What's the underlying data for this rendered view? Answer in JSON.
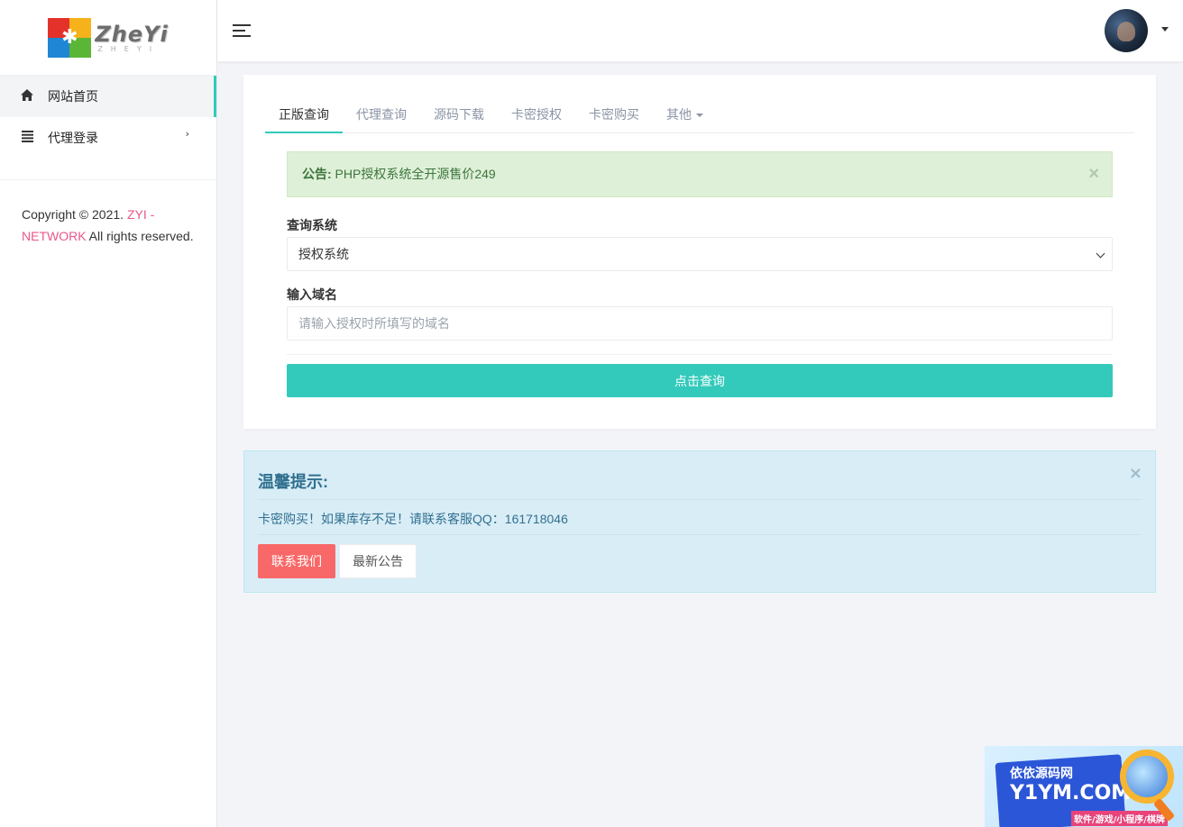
{
  "logo": {
    "title": "ZheYi",
    "subtitle": "ZHEYI"
  },
  "sidebar": {
    "items": [
      {
        "label": "网站首页",
        "icon": "home-icon",
        "active": true
      },
      {
        "label": "代理登录",
        "icon": "list-icon",
        "has_submenu": true
      }
    ],
    "copyright": {
      "prefix": "Copyright © 2021. ",
      "brand": "ZYI - NETWORK",
      "suffix": " All rights reserved."
    }
  },
  "topbar": {
    "menu_icon": "hamburger-icon",
    "avatar_icon": "user-avatar"
  },
  "tabs": [
    {
      "label": "正版查询",
      "active": true
    },
    {
      "label": "代理查询"
    },
    {
      "label": "源码下载"
    },
    {
      "label": "卡密授权"
    },
    {
      "label": "卡密购买"
    },
    {
      "label": "其他",
      "dropdown": true
    }
  ],
  "notice": {
    "prefix": "公告:",
    "text": " PHP授权系统全开源售价249",
    "close": "×"
  },
  "form": {
    "system_label": "查询系统",
    "system_value": "授权系统",
    "domain_label": "输入域名",
    "domain_placeholder": "请输入授权时所填写的域名",
    "submit_label": "点击查询"
  },
  "tips": {
    "title": "温馨提示:",
    "text": "卡密购买！如果库存不足！请联系客服QQ：161718046",
    "close": "×",
    "contact_label": "联系我们",
    "notice_label": "最新公告"
  },
  "watermark": {
    "cn": "依依源码网",
    "en": "Y1YM.COM",
    "sub": "软件/游戏/小程序/棋牌"
  },
  "colors": {
    "accent": "#33cabb",
    "danger": "#f96868",
    "brand_link": "#e8578b",
    "success_bg": "#dff0d8",
    "info_bg": "#d9edf7"
  }
}
